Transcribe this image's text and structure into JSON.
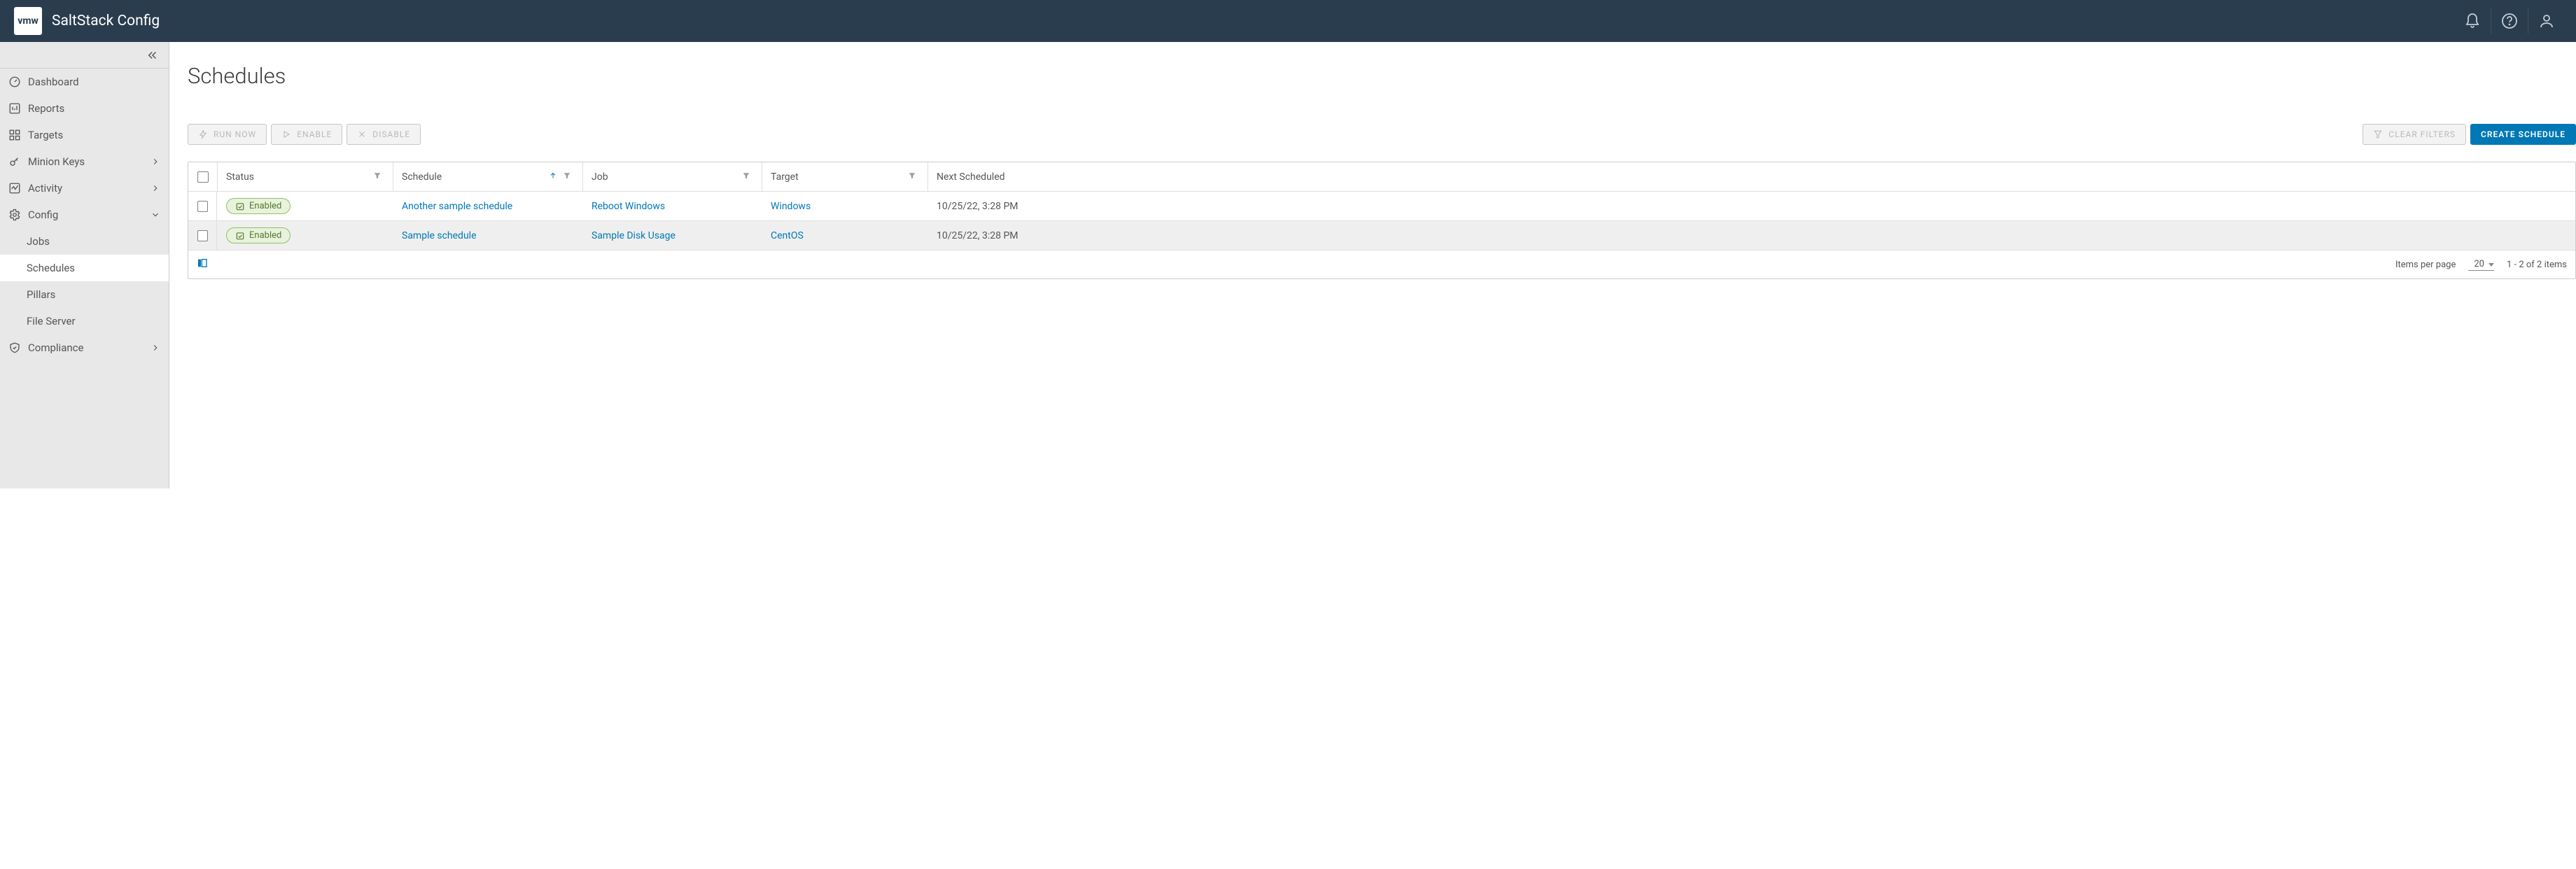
{
  "header": {
    "vmw_badge": "vmw",
    "product_title": "SaltStack Config"
  },
  "sidebar": {
    "items": [
      {
        "label": "Dashboard",
        "icon": "gauge"
      },
      {
        "label": "Reports",
        "icon": "reports"
      },
      {
        "label": "Targets",
        "icon": "grid"
      },
      {
        "label": "Minion Keys",
        "icon": "key",
        "chevron": "right"
      },
      {
        "label": "Activity",
        "icon": "activity",
        "chevron": "right"
      },
      {
        "label": "Config",
        "icon": "gear",
        "chevron": "down",
        "children": [
          {
            "label": "Jobs"
          },
          {
            "label": "Schedules",
            "active": true
          },
          {
            "label": "Pillars"
          },
          {
            "label": "File Server"
          }
        ]
      },
      {
        "label": "Compliance",
        "icon": "shield",
        "chevron": "right"
      }
    ]
  },
  "page": {
    "title": "Schedules",
    "toolbar": {
      "run_now": "RUN NOW",
      "enable": "ENABLE",
      "disable": "DISABLE",
      "clear_filters": "CLEAR FILTERS",
      "create": "CREATE SCHEDULE"
    },
    "columns": {
      "status": "Status",
      "schedule": "Schedule",
      "job": "Job",
      "target": "Target",
      "next": "Next Scheduled"
    },
    "rows": [
      {
        "status_label": "Enabled",
        "schedule": "Another sample schedule",
        "job": "Reboot Windows",
        "target": "Windows",
        "next": "10/25/22, 3:28 PM"
      },
      {
        "status_label": "Enabled",
        "schedule": "Sample schedule",
        "job": "Sample Disk Usage",
        "target": "CentOS",
        "next": "10/25/22, 3:28 PM"
      }
    ],
    "footer": {
      "items_per_page_label": "Items per page",
      "items_per_page_value": "20",
      "range": "1 - 2 of 2 items"
    }
  }
}
